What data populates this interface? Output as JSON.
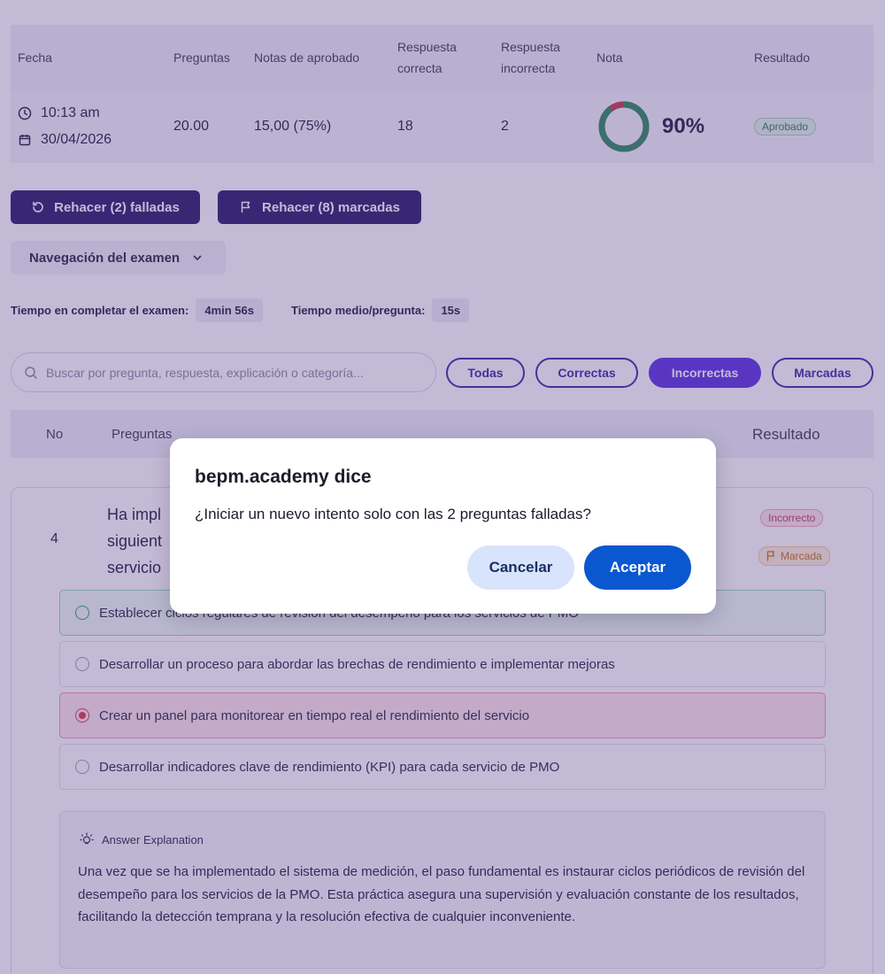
{
  "summary": {
    "headers": {
      "fecha": "Fecha",
      "preguntas": "Preguntas",
      "notas": "Notas de aprobado",
      "correcta_l1": "Respuesta",
      "correcta_l2": "correcta",
      "incorrecta_l1": "Respuesta",
      "incorrecta_l2": "incorrecta",
      "nota": "Nota",
      "resultado": "Resultado"
    },
    "row": {
      "time": "10:13 am",
      "date": "30/04/2026",
      "preguntas": "20.00",
      "notas": "15,00 (75%)",
      "correctas": "18",
      "incorrectas": "2",
      "nota_pct": "90%",
      "resultado": "Aprobado"
    },
    "score_fraction": 0.9,
    "colors": {
      "score_ok": "#2a8a5a",
      "score_bad": "#c23a4a"
    }
  },
  "actions": {
    "retry_failed": "Rehacer (2) falladas",
    "retry_marked": "Rehacer (8) marcadas",
    "nav_exam": "Navegación del examen"
  },
  "times": {
    "total_label": "Tiempo en completar el examen:",
    "total_value": "4min 56s",
    "avg_label": "Tiempo medio/pregunta:",
    "avg_value": "15s"
  },
  "search": {
    "placeholder": "Buscar por pregunta, respuesta, explicación o categoría..."
  },
  "filters": {
    "all": "Todas",
    "correct": "Correctas",
    "incorrect": "Incorrectas",
    "marked": "Marcadas",
    "active": "incorrect"
  },
  "question_table": {
    "col_no": "No",
    "col_questions": "Preguntas",
    "col_result": "Resultado"
  },
  "question": {
    "number": "4",
    "text": "Ha impl siguient servicio",
    "text_lines": [
      "Ha impl",
      "siguient",
      "servicio"
    ],
    "result_badge": "Incorrecto",
    "marked_badge": "Marcada",
    "options": [
      {
        "text": "Establecer ciclos regulares de revisión del desempeño para los servicios de PMO",
        "state": "correct"
      },
      {
        "text": "Desarrollar un proceso para abordar las brechas de rendimiento e implementar mejoras",
        "state": "none"
      },
      {
        "text": "Crear un panel para monitorear en tiempo real el rendimiento del servicio",
        "state": "selected-wrong"
      },
      {
        "text": "Desarrollar indicadores clave de rendimiento (KPI) para cada servicio de PMO",
        "state": "none"
      }
    ],
    "explanation_title": "Answer Explanation",
    "explanation": "Una vez que se ha implementado el sistema de medición, el paso fundamental es instaurar ciclos periódicos de revisión del desempeño para los servicios de la PMO. Esta práctica asegura una supervisión y evaluación constante de los resultados, facilitando la detección temprana y la resolución efectiva de cualquier inconveniente."
  },
  "dialog": {
    "title": "bepm.academy dice",
    "message": "¿Iniciar un nuevo intento solo con las 2 preguntas falladas?",
    "cancel": "Cancelar",
    "accept": "Aceptar"
  }
}
